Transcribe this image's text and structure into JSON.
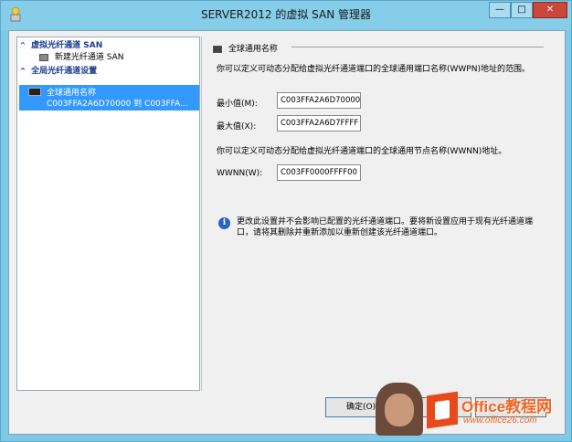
{
  "window": {
    "title": "SERVER2012 的虚拟 SAN 管理器",
    "min_label": "—",
    "max_label": "□",
    "close_label": "✕"
  },
  "tree": {
    "group1": {
      "label": "虚拟光纤通道 SAN",
      "chevron": "^"
    },
    "group1_item": "新建光纤通道 SAN",
    "group2": {
      "label": "全局光纤通道设置",
      "chevron": "^"
    },
    "selected": {
      "line1": "全球通用名称",
      "line2": "C003FFA2A6D70000 到 C003FFA..."
    }
  },
  "details": {
    "section_title": "全球通用名称",
    "wwpn_desc": "你可以定义可动态分配给虚拟光纤通道端口的全球通用端口名称(WWPN)地址的范围。",
    "min_label": "最小值(M):",
    "min_value": "C003FFA2A6D70000",
    "max_label": "最大值(X):",
    "max_value": "C003FFA2A6D7FFFF",
    "wwnn_desc": "你可以定义可动态分配给虚拟光纤通道端口的全球通用节点名称(WWNN)地址。",
    "wwnn_label": "WWNN(W):",
    "wwnn_value": "C003FF0000FFFF00",
    "info_glyph": "i",
    "info_text": "更改此设置并不会影响已配置的光纤通道端口。要将新设置应用于现有光纤通道端口，请将其删除并重新添加以重新创建该光纤通道端口。"
  },
  "buttons": {
    "ok": "确定(O)",
    "cancel": "",
    "apply": ""
  },
  "watermark": {
    "brand": "Office教程网",
    "url": "www.office26.com"
  }
}
